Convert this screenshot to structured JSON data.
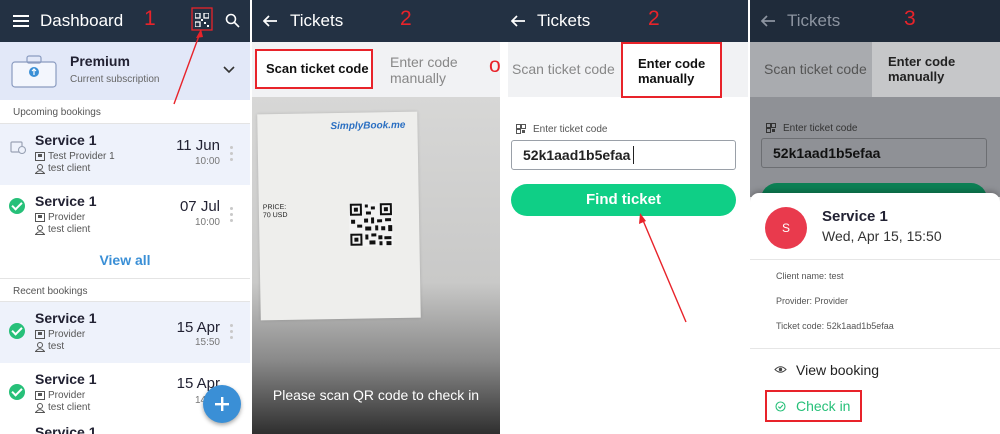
{
  "colors": {
    "header": "#233143",
    "accent": "#0fcf86",
    "blue": "#3a8fd6",
    "red": "#e8232a",
    "check": "#27c079"
  },
  "panel1": {
    "title": "Dashboard",
    "step": "1",
    "icons": [
      "menu-icon",
      "qr-code-icon",
      "search-icon",
      "briefcase-icon",
      "chevron-down-icon",
      "plus-icon"
    ],
    "subscription": {
      "name": "Premium",
      "caption": "Current subscription"
    },
    "upcoming_heading": "Upcoming bookings",
    "upcoming": [
      {
        "service": "Service 1",
        "provider": "Test Provider 1",
        "client": "test client",
        "date": "11 Jun",
        "time": "10:00"
      },
      {
        "service": "Service 1",
        "provider": "Provider",
        "client": "test client",
        "date": "07 Jul",
        "time": "10:00"
      }
    ],
    "view_all": "View all",
    "recent_heading": "Recent bookings",
    "recent": [
      {
        "service": "Service 1",
        "provider": "Provider",
        "client": "test",
        "date": "15 Apr",
        "time": "15:50"
      },
      {
        "service": "Service 1",
        "provider": "Provider",
        "client": "test client",
        "date": "15 Apr",
        "time": "14:50"
      }
    ],
    "partial_service": "Service 1"
  },
  "panel2": {
    "title": "Tickets",
    "step": "2",
    "tab_scan": "Scan ticket code",
    "tab_manual": "Enter code manually",
    "brand": "SimplyBook.me",
    "price_label": "PRICE:",
    "price_value": "70 USD",
    "scan_prompt": "Please scan QR code to check in"
  },
  "or_label": "or",
  "panel3": {
    "title": "Tickets",
    "step": "2",
    "tab_scan": "Scan ticket code",
    "tab_manual": "Enter code manually",
    "field_label": "Enter ticket code",
    "field_value": "52k1aad1b5efaa",
    "button": "Find ticket"
  },
  "panel4": {
    "title": "Tickets",
    "step": "3",
    "tab_scan": "Scan ticket code",
    "tab_manual": "Enter code manually",
    "field_label": "Enter ticket code",
    "field_value": "52k1aad1b5efaa",
    "avatar": "S",
    "service": "Service 1",
    "datetime": "Wed, Apr 15, 15:50",
    "client": "Client name: test",
    "provider": "Provider: Provider",
    "ticket": "Ticket code: 52k1aad1b5efaa",
    "view_booking": "View booking",
    "check_in": "Check in"
  }
}
